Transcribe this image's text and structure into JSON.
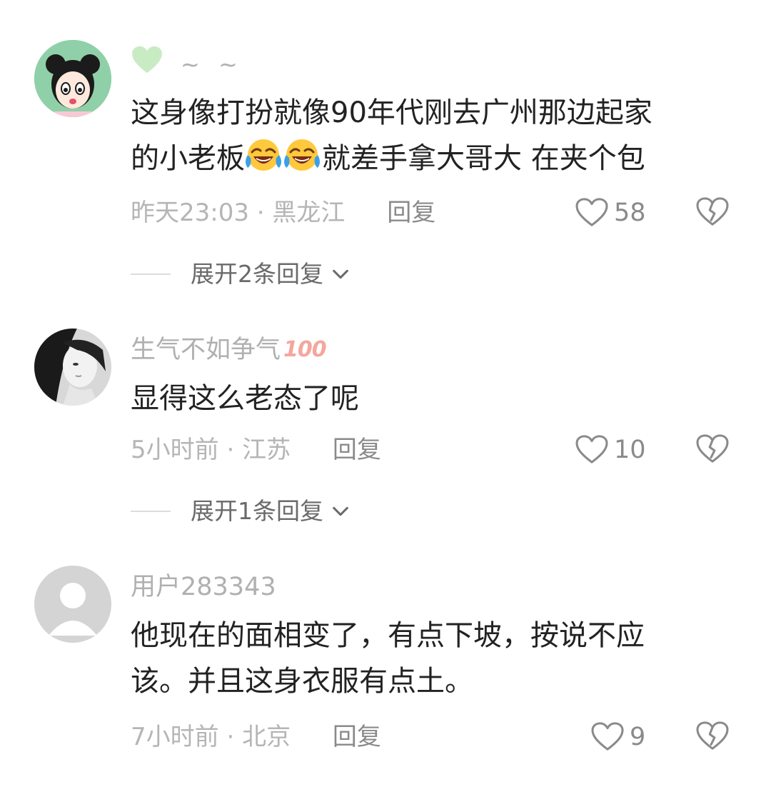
{
  "comments": [
    {
      "username": "~ ~",
      "content_line1": "这身像打扮就像90年代刚去广州那边起家",
      "content_line2_pre": "的小老板",
      "content_line2_post": "就差手拿大哥大  在夹个包",
      "time": "昨天23:03",
      "location": "黑龙江",
      "reply_label": "回复",
      "likes": "58",
      "expand_label": "展开2条回复",
      "emoji": "laughing-crying-emoji"
    },
    {
      "username": "生气不如争气",
      "badge": "100",
      "content": "显得这么老态了呢",
      "time": "5小时前",
      "location": "江苏",
      "reply_label": "回复",
      "likes": "10",
      "expand_label": "展开1条回复"
    },
    {
      "username": "用户283343",
      "content_line1": "他现在的面相变了，有点下坡，按说不应",
      "content_line2": "该。并且这身衣服有点土。",
      "time": "7小时前",
      "location": "北京",
      "reply_label": "回复",
      "likes": "9"
    }
  ],
  "separator": " · ",
  "colors": {
    "background": "#ffffff",
    "text": "#222222",
    "muted": "#b0b0b0",
    "badge_heart": "#c8ebc3"
  }
}
